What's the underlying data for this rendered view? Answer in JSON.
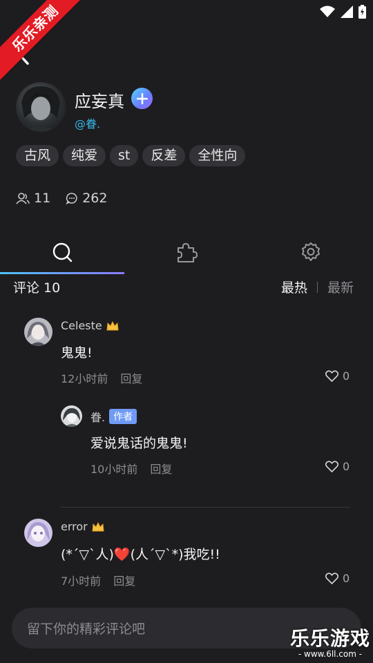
{
  "ribbon": {
    "text": "乐乐亲测"
  },
  "profile": {
    "name": "应妄真",
    "handle": "@眷.",
    "tags": [
      "古风",
      "纯爱",
      "st",
      "反差",
      "全性向"
    ],
    "followers": "11",
    "comments": "262"
  },
  "tabs": {
    "active": "search",
    "items": [
      "search-icon",
      "puzzle-icon",
      "settings-icon"
    ]
  },
  "comments_header": {
    "label": "评论 10",
    "sort_hot": "最热",
    "sort_new": "最新"
  },
  "comments": [
    {
      "username": "Celeste",
      "text": "鬼鬼!",
      "time": "12小时前",
      "reply": "回复",
      "likes": "0",
      "replies": [
        {
          "username": "眷.",
          "badge": "作者",
          "text": "爱说鬼话的鬼鬼!",
          "time": "10小时前",
          "reply": "回复",
          "likes": "0"
        }
      ]
    },
    {
      "username": "error",
      "text": "(*´▽`人)❤️(人´▽`*)我吃!!",
      "time": "7小时前",
      "reply": "回复",
      "likes": "0"
    }
  ],
  "input": {
    "placeholder": "留下你的精彩评论吧"
  },
  "watermark": {
    "title": "乐乐游戏",
    "url": "- www.6ll.com -"
  },
  "colors": {
    "accent": "#39b7e8",
    "background": "#1d1d20",
    "ribbon": "#e21b24",
    "badge": "#6f9bf5"
  }
}
